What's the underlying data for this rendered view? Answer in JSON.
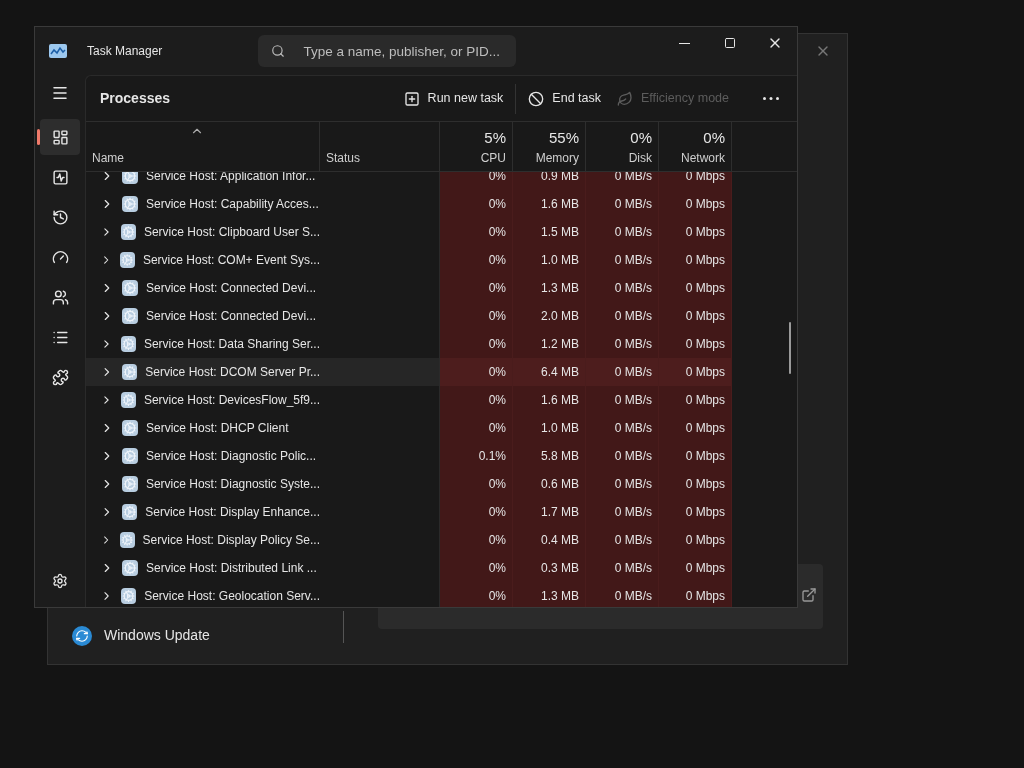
{
  "background_window": {
    "nav_item": "Windows Update"
  },
  "window": {
    "title": "Task Manager"
  },
  "search": {
    "placeholder": "Type a name, publisher, or PID..."
  },
  "nav_items": [
    {
      "kind": "processes",
      "selected": true
    },
    {
      "kind": "performance",
      "selected": false
    },
    {
      "kind": "history",
      "selected": false
    },
    {
      "kind": "startup",
      "selected": false
    },
    {
      "kind": "users",
      "selected": false
    },
    {
      "kind": "details",
      "selected": false
    },
    {
      "kind": "services",
      "selected": false
    }
  ],
  "page_title": "Processes",
  "toolbar": [
    {
      "kind": "run",
      "label": "Run new task",
      "disabled": false
    },
    {
      "kind": "end",
      "label": "End task",
      "disabled": false
    },
    {
      "kind": "efficiency",
      "label": "Efficiency mode",
      "disabled": true
    }
  ],
  "table": {
    "columns": [
      {
        "label": "Name"
      },
      {
        "label": "Status"
      },
      {
        "percent": "5%",
        "label": "CPU"
      },
      {
        "percent": "55%",
        "label": "Memory"
      },
      {
        "percent": "0%",
        "label": "Disk"
      },
      {
        "percent": "0%",
        "label": "Network"
      }
    ],
    "rows": [
      {
        "name": "Service Host: Application Infor...",
        "cpu": "0%",
        "memory": "0.9 MB",
        "disk": "0 MB/s",
        "network": "0 Mbps",
        "selected": false
      },
      {
        "name": "Service Host: Capability Acces...",
        "cpu": "0%",
        "memory": "1.6 MB",
        "disk": "0 MB/s",
        "network": "0 Mbps",
        "selected": false
      },
      {
        "name": "Service Host: Clipboard User S...",
        "cpu": "0%",
        "memory": "1.5 MB",
        "disk": "0 MB/s",
        "network": "0 Mbps",
        "selected": false
      },
      {
        "name": "Service Host: COM+ Event Sys...",
        "cpu": "0%",
        "memory": "1.0 MB",
        "disk": "0 MB/s",
        "network": "0 Mbps",
        "selected": false
      },
      {
        "name": "Service Host: Connected Devi...",
        "cpu": "0%",
        "memory": "1.3 MB",
        "disk": "0 MB/s",
        "network": "0 Mbps",
        "selected": false
      },
      {
        "name": "Service Host: Connected Devi...",
        "cpu": "0%",
        "memory": "2.0 MB",
        "disk": "0 MB/s",
        "network": "0 Mbps",
        "selected": false
      },
      {
        "name": "Service Host: Data Sharing Ser...",
        "cpu": "0%",
        "memory": "1.2 MB",
        "disk": "0 MB/s",
        "network": "0 Mbps",
        "selected": false
      },
      {
        "name": "Service Host: DCOM Server Pr...",
        "cpu": "0%",
        "memory": "6.4 MB",
        "disk": "0 MB/s",
        "network": "0 Mbps",
        "selected": true
      },
      {
        "name": "Service Host: DevicesFlow_5f9...",
        "cpu": "0%",
        "memory": "1.6 MB",
        "disk": "0 MB/s",
        "network": "0 Mbps",
        "selected": false
      },
      {
        "name": "Service Host: DHCP Client",
        "cpu": "0%",
        "memory": "1.0 MB",
        "disk": "0 MB/s",
        "network": "0 Mbps",
        "selected": false
      },
      {
        "name": "Service Host: Diagnostic Polic...",
        "cpu": "0.1%",
        "memory": "5.8 MB",
        "disk": "0 MB/s",
        "network": "0 Mbps",
        "selected": false
      },
      {
        "name": "Service Host: Diagnostic Syste...",
        "cpu": "0%",
        "memory": "0.6 MB",
        "disk": "0 MB/s",
        "network": "0 Mbps",
        "selected": false
      },
      {
        "name": "Service Host: Display Enhance...",
        "cpu": "0%",
        "memory": "1.7 MB",
        "disk": "0 MB/s",
        "network": "0 Mbps",
        "selected": false
      },
      {
        "name": "Service Host: Display Policy Se...",
        "cpu": "0%",
        "memory": "0.4 MB",
        "disk": "0 MB/s",
        "network": "0 Mbps",
        "selected": false
      },
      {
        "name": "Service Host: Distributed Link ...",
        "cpu": "0%",
        "memory": "0.3 MB",
        "disk": "0 MB/s",
        "network": "0 Mbps",
        "selected": false
      },
      {
        "name": "Service Host: Geolocation Serv...",
        "cpu": "0%",
        "memory": "1.3 MB",
        "disk": "0 MB/s",
        "network": "0 Mbps",
        "selected": false
      }
    ]
  }
}
